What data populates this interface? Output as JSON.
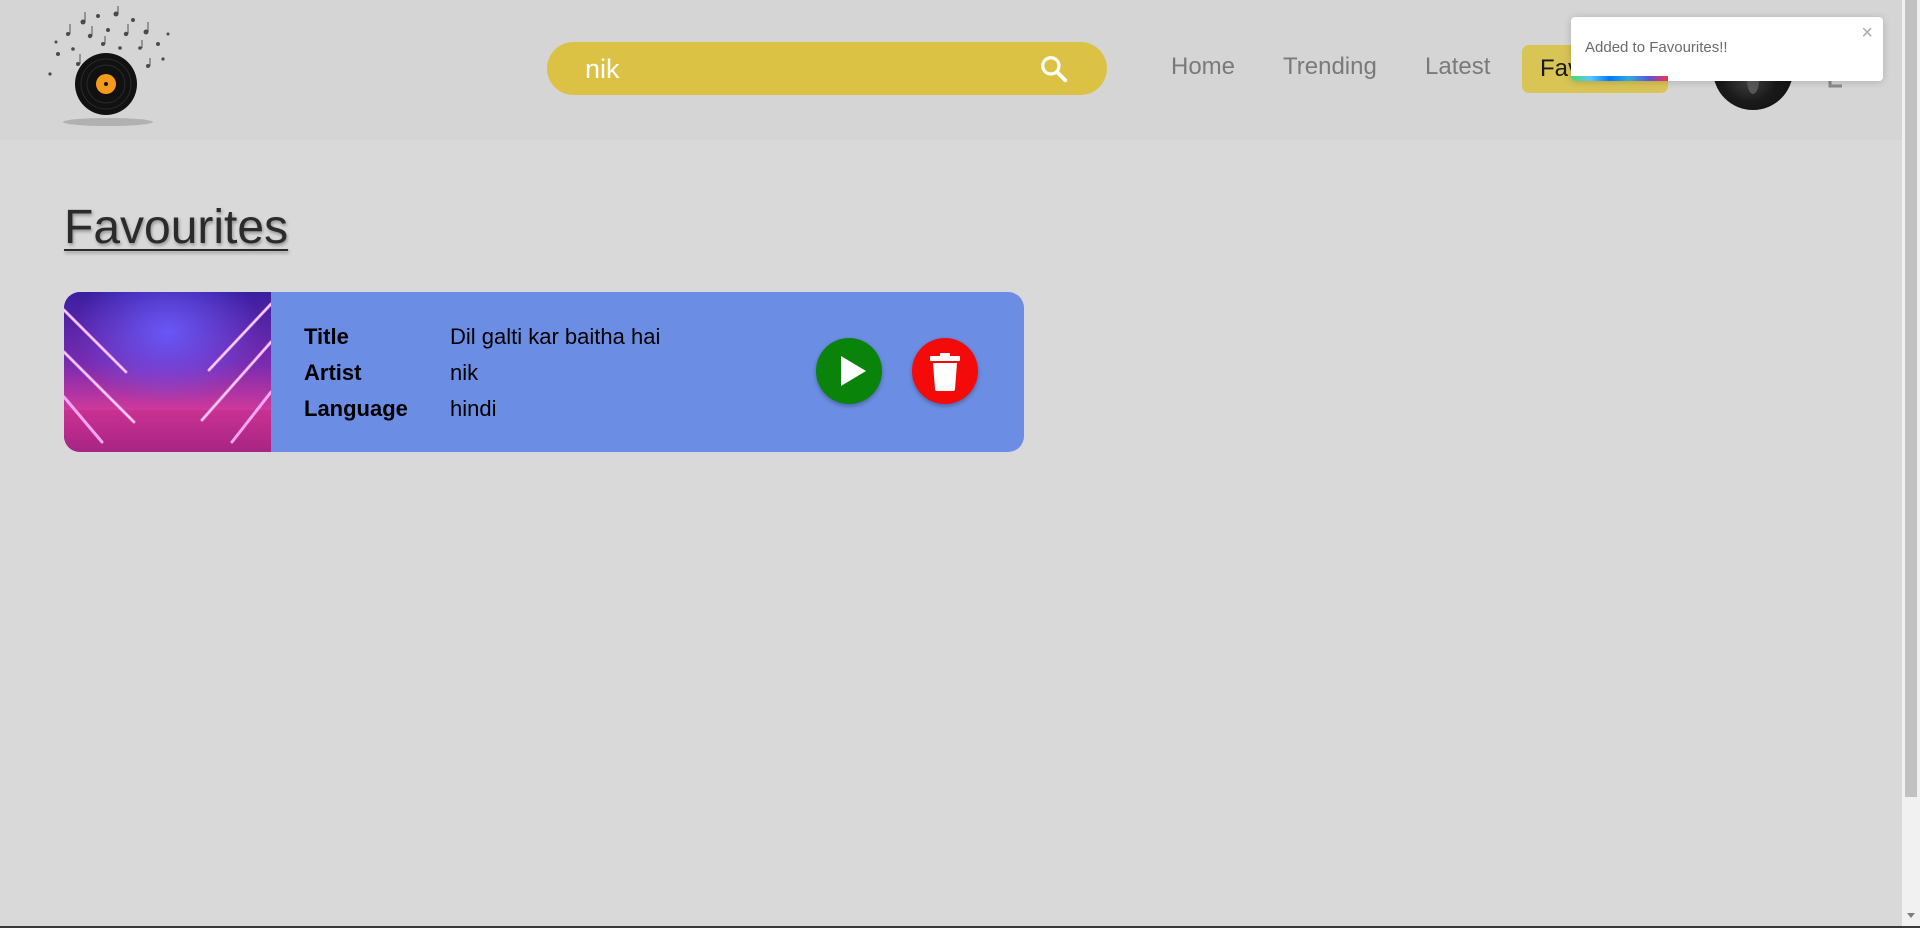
{
  "header": {
    "search": {
      "value": "nik",
      "icon": "search-icon"
    },
    "nav": {
      "home": "Home",
      "trending": "Trending",
      "latest": "Latest",
      "favourites": "Favourites"
    },
    "avatar_icon": "avatar",
    "logout_icon": "logout-icon"
  },
  "toast": {
    "message": "Added to Favourites!!",
    "close": "×",
    "progress_fraction": 0.31
  },
  "main": {
    "title": "Favourites",
    "cards": [
      {
        "title_label": "Title",
        "title_value": "Dil galti kar baitha hai",
        "artist_label": "Artist",
        "artist_value": "nik",
        "language_label": "Language",
        "language_value": "hindi",
        "play_icon": "play-icon",
        "delete_icon": "trash-icon"
      }
    ]
  },
  "colors": {
    "search_bg": "#dcc244",
    "card_bg": "#6b8de3",
    "play_button": "#0a830a",
    "delete_button": "#f50a0a"
  }
}
